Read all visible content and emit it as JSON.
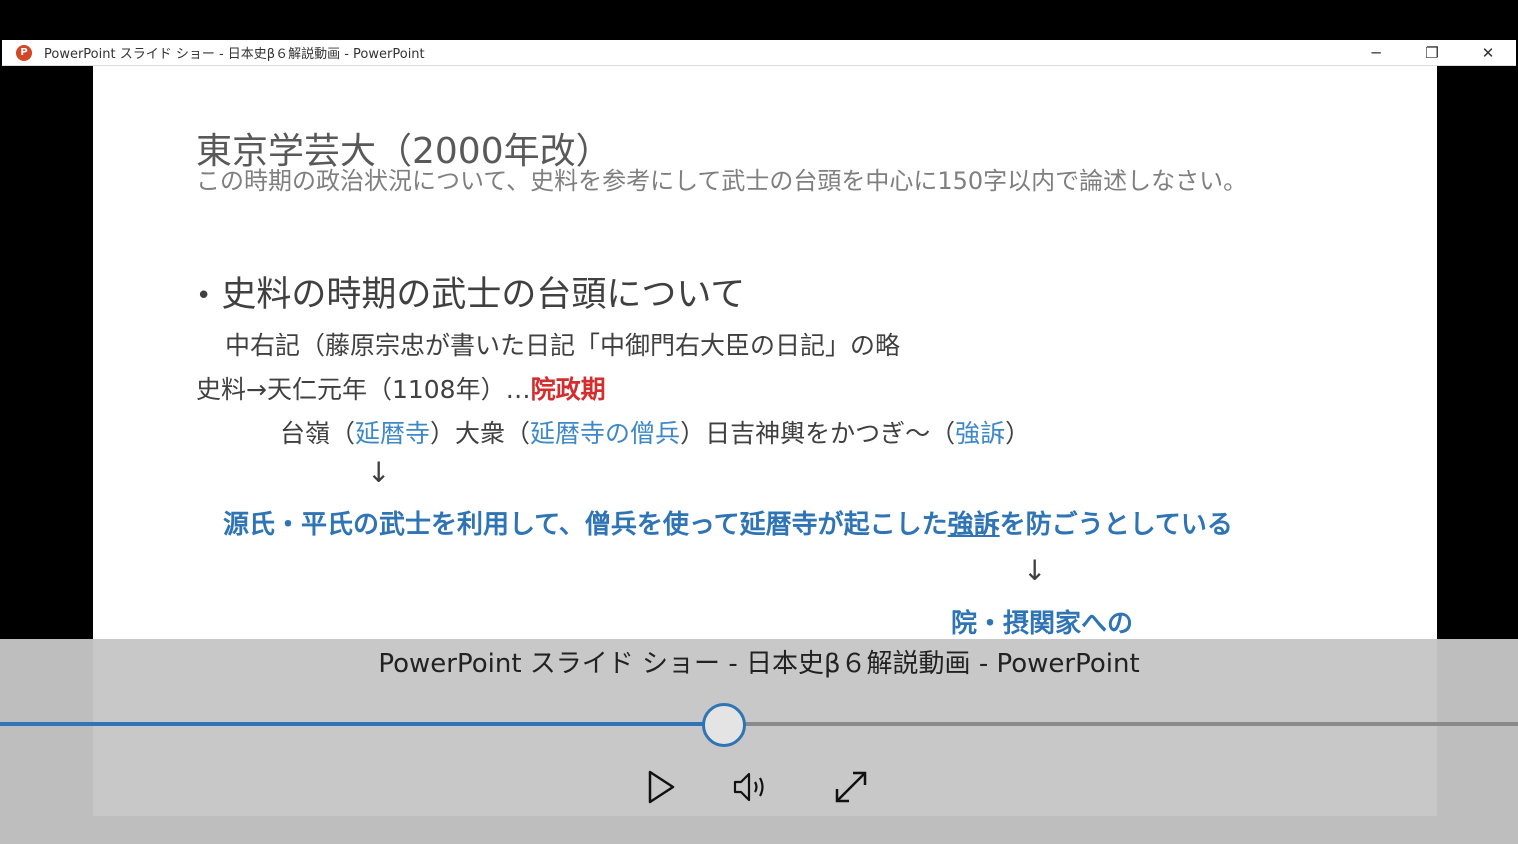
{
  "window": {
    "title": "PowerPoint スライド ショー  -  日本史β６解説動画 - PowerPoint",
    "minimize_label": "─",
    "restore_label": "❐",
    "close_label": "✕"
  },
  "slide": {
    "title": "東京学芸大（2000年改）",
    "question": "この時期の政治状況について、史料を参考にして武士の台頭を中心に150字以内で論述しなさい。",
    "bullet_heading": "史料の時期の武士の台頭について",
    "line1": "中右記（藤原宗忠が書いた日記「中御門右大臣の日記」の略",
    "line2_prefix": "史料→天仁元年（1108年）…",
    "line2_emphasis": "院政期",
    "line3": {
      "p1": "台嶺（",
      "b1": "延暦寺",
      "p2": "）大衆（",
      "b2": "延暦寺の僧兵",
      "p3": "）日吉神輿をかつぎ～（",
      "b3": "強訴",
      "p4": "）"
    },
    "arrow": "↓",
    "line4_prefix": "源氏・平氏の武士を利用して、僧兵を使って延暦寺が起こした",
    "line4_underlined": "強訴",
    "line4_suffix": "を防ごうとしている",
    "line5": "院・摂関家への"
  },
  "player": {
    "caption": "PowerPoint スライド ショー  -  日本史β６解説動画 - PowerPoint",
    "progress_percent": 47.6
  },
  "colors": {
    "accent_blue": "#2f74b5",
    "highlight_red": "#d32d2d"
  },
  "icons": {
    "play": "play-icon",
    "volume": "volume-icon",
    "fullscreen": "fullscreen-icon"
  }
}
